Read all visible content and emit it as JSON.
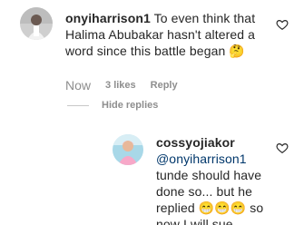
{
  "comment": {
    "username": "onyiharrison1",
    "text": "To even think that Halima Abubakar hasn't altered a word since this battle began 🤔",
    "time": "Now",
    "likes": "3 likes",
    "reply_label": "Reply",
    "hide_replies_label": "Hide replies"
  },
  "reply": {
    "username": "cossyojiakor",
    "mention": "@onyiharrison1",
    "text": "tunde should have done so... but he replied 😁😁😁 so now I will sue"
  },
  "icons": {
    "heart": "heart-outline-icon",
    "avatar_main": "avatar-onyiharrison1",
    "avatar_reply": "avatar-cossyojiakor"
  },
  "colors": {
    "text": "#262626",
    "muted": "#8e8e8e",
    "mention": "#00376b"
  }
}
